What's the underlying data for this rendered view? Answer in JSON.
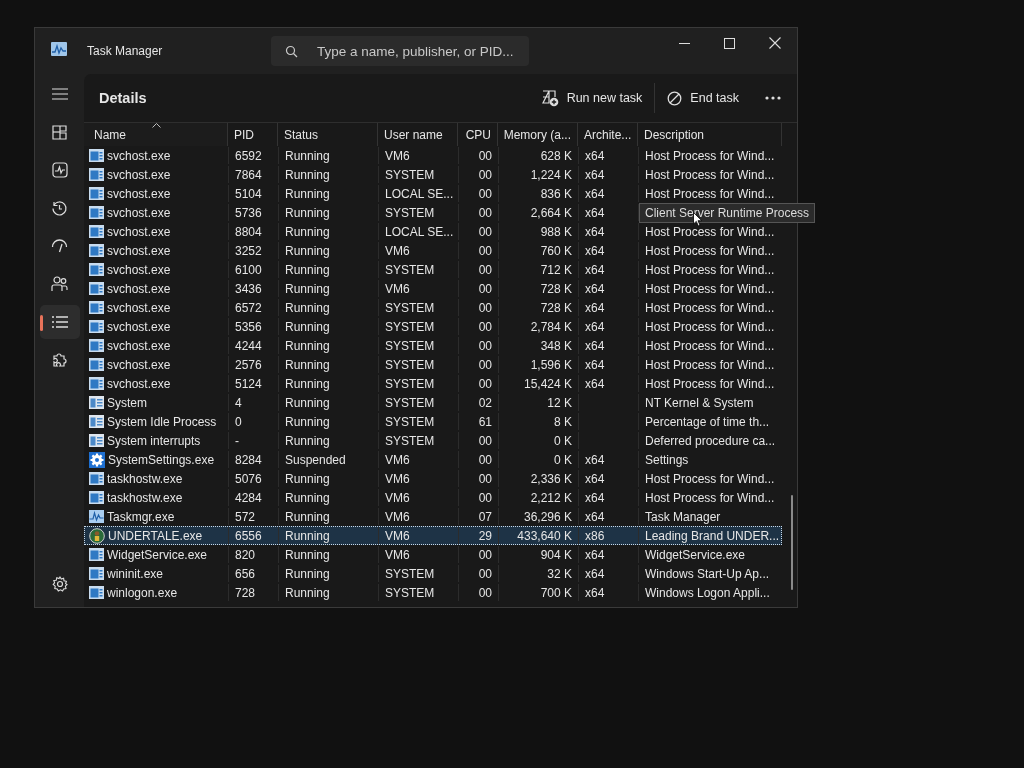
{
  "window": {
    "title": "Task Manager"
  },
  "search": {
    "placeholder": "Type a name, publisher, or PID..."
  },
  "sidebar": {
    "items": [
      {
        "selected": false
      },
      {
        "selected": false
      },
      {
        "selected": false
      },
      {
        "selected": false
      },
      {
        "selected": false
      },
      {
        "selected": true
      },
      {
        "selected": false
      }
    ]
  },
  "page": {
    "title": "Details",
    "actions": [
      {
        "kind": "run",
        "label": "Run new task"
      },
      {
        "kind": "end",
        "label": "End task"
      }
    ]
  },
  "table": {
    "columns": [
      {
        "label": "Name",
        "sorted": true
      },
      {
        "label": "PID",
        "sorted": false
      },
      {
        "label": "Status",
        "sorted": false
      },
      {
        "label": "User name",
        "sorted": false
      },
      {
        "label": "CPU",
        "sorted": false
      },
      {
        "label": "Memory (a...",
        "sorted": false
      },
      {
        "label": "Archite...",
        "sorted": false
      },
      {
        "label": "Description",
        "sorted": false
      }
    ],
    "rows": [
      {
        "kind": "service",
        "selected": false,
        "cells": [
          "svchost.exe",
          "6592",
          "Running",
          "VM6",
          "00",
          "628 K",
          "x64",
          "Host Process for Wind..."
        ]
      },
      {
        "kind": "service",
        "selected": false,
        "cells": [
          "svchost.exe",
          "7864",
          "Running",
          "SYSTEM",
          "00",
          "1,224 K",
          "x64",
          "Host Process for Wind..."
        ]
      },
      {
        "kind": "service",
        "selected": false,
        "cells": [
          "svchost.exe",
          "5104",
          "Running",
          "LOCAL SE...",
          "00",
          "836 K",
          "x64",
          "Host Process for Wind..."
        ]
      },
      {
        "kind": "service",
        "selected": false,
        "cells": [
          "svchost.exe",
          "5736",
          "Running",
          "SYSTEM",
          "00",
          "2,664 K",
          "x64"
        ],
        "tooltip": "Client Server Runtime Process"
      },
      {
        "kind": "service",
        "selected": false,
        "cells": [
          "svchost.exe",
          "8804",
          "Running",
          "LOCAL SE...",
          "00",
          "988 K",
          "x64",
          "Host Process for Wind..."
        ]
      },
      {
        "kind": "service",
        "selected": false,
        "cells": [
          "svchost.exe",
          "3252",
          "Running",
          "VM6",
          "00",
          "760 K",
          "x64",
          "Host Process for Wind..."
        ]
      },
      {
        "kind": "service",
        "selected": false,
        "cells": [
          "svchost.exe",
          "6100",
          "Running",
          "SYSTEM",
          "00",
          "712 K",
          "x64",
          "Host Process for Wind..."
        ]
      },
      {
        "kind": "service",
        "selected": false,
        "cells": [
          "svchost.exe",
          "3436",
          "Running",
          "VM6",
          "00",
          "728 K",
          "x64",
          "Host Process for Wind..."
        ]
      },
      {
        "kind": "service",
        "selected": false,
        "cells": [
          "svchost.exe",
          "6572",
          "Running",
          "SYSTEM",
          "00",
          "728 K",
          "x64",
          "Host Process for Wind..."
        ]
      },
      {
        "kind": "service",
        "selected": false,
        "cells": [
          "svchost.exe",
          "5356",
          "Running",
          "SYSTEM",
          "00",
          "2,784 K",
          "x64",
          "Host Process for Wind..."
        ]
      },
      {
        "kind": "service",
        "selected": false,
        "cells": [
          "svchost.exe",
          "4244",
          "Running",
          "SYSTEM",
          "00",
          "348 K",
          "x64",
          "Host Process for Wind..."
        ]
      },
      {
        "kind": "service",
        "selected": false,
        "cells": [
          "svchost.exe",
          "2576",
          "Running",
          "SYSTEM",
          "00",
          "1,596 K",
          "x64",
          "Host Process for Wind..."
        ]
      },
      {
        "kind": "service",
        "selected": false,
        "cells": [
          "svchost.exe",
          "5124",
          "Running",
          "SYSTEM",
          "00",
          "15,424 K",
          "x64",
          "Host Process for Wind..."
        ]
      },
      {
        "kind": "system",
        "selected": false,
        "cells": [
          "System",
          "4",
          "Running",
          "SYSTEM",
          "02",
          "12 K",
          "",
          "NT Kernel & System"
        ]
      },
      {
        "kind": "system",
        "selected": false,
        "cells": [
          "System Idle Process",
          "0",
          "Running",
          "SYSTEM",
          "61",
          "8 K",
          "",
          "Percentage of time th..."
        ]
      },
      {
        "kind": "system",
        "selected": false,
        "cells": [
          "System interrupts",
          "-",
          "Running",
          "SYSTEM",
          "00",
          "0 K",
          "",
          "Deferred procedure ca..."
        ]
      },
      {
        "kind": "gear",
        "selected": false,
        "cells": [
          "SystemSettings.exe",
          "8284",
          "Suspended",
          "VM6",
          "00",
          "0 K",
          "x64",
          "Settings"
        ]
      },
      {
        "kind": "service",
        "selected": false,
        "cells": [
          "taskhostw.exe",
          "5076",
          "Running",
          "VM6",
          "00",
          "2,336 K",
          "x64",
          "Host Process for Wind..."
        ]
      },
      {
        "kind": "service",
        "selected": false,
        "cells": [
          "taskhostw.exe",
          "4284",
          "Running",
          "VM6",
          "00",
          "2,212 K",
          "x64",
          "Host Process for Wind..."
        ]
      },
      {
        "kind": "monitor",
        "selected": false,
        "cells": [
          "Taskmgr.exe",
          "572",
          "Running",
          "VM6",
          "07",
          "36,296 K",
          "x64",
          "Task Manager"
        ]
      },
      {
        "kind": "game",
        "selected": true,
        "cells": [
          "UNDERTALE.exe",
          "6556",
          "Running",
          "VM6",
          "29",
          "433,640 K",
          "x86",
          "Leading Brand UNDER..."
        ]
      },
      {
        "kind": "service",
        "selected": false,
        "cells": [
          "WidgetService.exe",
          "820",
          "Running",
          "VM6",
          "00",
          "904 K",
          "x64",
          "WidgetService.exe"
        ]
      },
      {
        "kind": "service",
        "selected": false,
        "cells": [
          "wininit.exe",
          "656",
          "Running",
          "SYSTEM",
          "00",
          "32 K",
          "x64",
          "Windows Start-Up Ap..."
        ]
      },
      {
        "kind": "service",
        "selected": false,
        "cells": [
          "winlogon.exe",
          "728",
          "Running",
          "SYSTEM",
          "00",
          "700 K",
          "x64",
          "Windows Logon Appli..."
        ]
      }
    ]
  }
}
